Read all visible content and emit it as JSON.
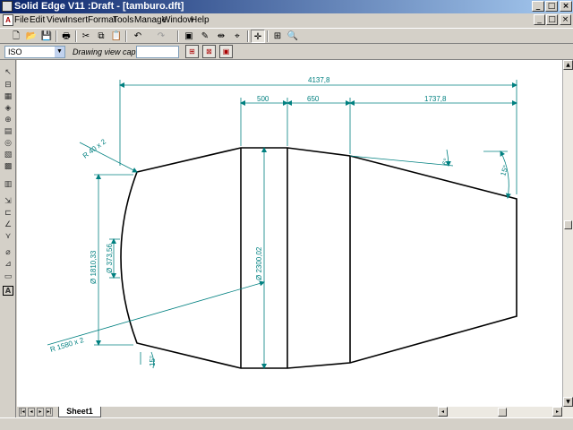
{
  "window": {
    "title": "Solid Edge V11 :Draft - [tamburo.dft]",
    "controls": [
      "_",
      "□",
      "×"
    ]
  },
  "menu": {
    "items": [
      "File",
      "Edit",
      "View",
      "Insert",
      "Format",
      "Tools",
      "Manage",
      "Window",
      "Help"
    ],
    "doc_controls": [
      "_",
      "□",
      "×"
    ]
  },
  "toolbar": {
    "buttons": [
      {
        "name": "new-icon",
        "glyph": "🗋"
      },
      {
        "name": "open-icon",
        "glyph": "📂"
      },
      {
        "name": "save-icon",
        "glyph": "💾"
      },
      {
        "name": "print-icon",
        "glyph": "🖶"
      },
      {
        "name": "cut-icon",
        "glyph": "✂"
      },
      {
        "name": "copy-icon",
        "glyph": "⧉"
      },
      {
        "name": "paste-icon",
        "glyph": "📋"
      },
      {
        "name": "undo-icon",
        "glyph": "↶"
      },
      {
        "name": "redo-icon",
        "glyph": "↷"
      },
      {
        "name": "sheet-setup-icon",
        "glyph": "▣"
      },
      {
        "name": "draw-icon",
        "glyph": "✎"
      },
      {
        "name": "dimension-icon",
        "glyph": "⇹"
      },
      {
        "name": "relation-icon",
        "glyph": "⌖"
      },
      {
        "name": "select-tool-icon",
        "glyph": "✛"
      },
      {
        "name": "zoom-area-icon",
        "glyph": "⊞"
      },
      {
        "name": "zoom-icon",
        "glyph": "🔍"
      }
    ]
  },
  "ribbon": {
    "standard_value": "ISO",
    "caption_label": "Drawing view caption:",
    "caption_value": "",
    "buttons": [
      "view-properties-icon",
      "view-update-icon",
      "view-options-icon"
    ]
  },
  "left_tools": [
    {
      "name": "select-arrow-icon",
      "glyph": "↖"
    },
    {
      "name": "view-wizard-icon",
      "glyph": "⊟"
    },
    {
      "name": "principal-view-icon",
      "glyph": "▦"
    },
    {
      "name": "auxiliary-view-icon",
      "glyph": "◈"
    },
    {
      "name": "section-view-icon",
      "glyph": "⊕"
    },
    {
      "name": "detail-view-icon",
      "glyph": "▤"
    },
    {
      "name": "broken-view-icon",
      "glyph": "◎"
    },
    {
      "name": "drawing-view-icon",
      "glyph": "▧"
    },
    {
      "name": "view-layout-icon",
      "glyph": "▩"
    },
    {
      "name": "part-list-icon",
      "glyph": "▥"
    },
    {
      "name": "smart-dimension-icon",
      "glyph": "⇲"
    },
    {
      "name": "distance-dimension-icon",
      "glyph": "⊏"
    },
    {
      "name": "angle-dimension-icon",
      "glyph": "∠"
    },
    {
      "name": "coordinate-dimension-icon",
      "glyph": "⋎"
    },
    {
      "name": "symmetric-diameter-icon",
      "glyph": "⌀"
    },
    {
      "name": "chamfer-dimension-icon",
      "glyph": "⊿"
    },
    {
      "name": "callout-icon",
      "glyph": "▭"
    },
    {
      "name": "text-icon",
      "glyph": "A"
    }
  ],
  "drawing": {
    "dimensions": {
      "overall_length": "4137,8",
      "seg_1": "500",
      "seg_2": "650",
      "seg_3": "1737,8",
      "top_radius": "R 40 x 2",
      "bottom_radius": "R 1580 x 2",
      "height_left": "Ø 1810,33",
      "small_diameter": "Ø 373,56",
      "main_diameter": "Ø 2300,02",
      "angle_small": "6°",
      "angle_large": "15°",
      "angle_bottom": "15°"
    }
  },
  "sheets": {
    "tabs": [
      "Sheet1"
    ],
    "nav": [
      "|◂",
      "◂",
      "▸",
      "▸|"
    ]
  },
  "scroll": {
    "up": "▲",
    "down": "▼",
    "left": "◂",
    "right": "▸"
  }
}
